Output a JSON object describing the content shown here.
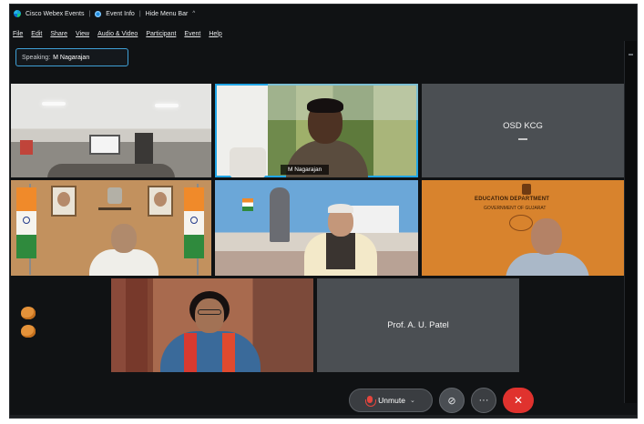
{
  "titlebar": {
    "app_name": "Cisco Webex Events",
    "event_info": "Event Info",
    "hide_menu": "Hide Menu Bar",
    "caret": "^"
  },
  "menu": [
    "File",
    "Edit",
    "Share",
    "View",
    "Audio & Video",
    "Participant",
    "Event",
    "Help"
  ],
  "speaking": {
    "label": "Speaking:",
    "name": "M Nagarajan"
  },
  "tiles": {
    "speaker_name": "M Nagarajan",
    "osd_name": "OSD KCG",
    "edu_line1": "EDUCATION DEPARTMENT",
    "edu_line2": "GOVERNMENT OF GUJARAT",
    "patel_name": "Prof. A. U. Patel"
  },
  "controls": {
    "unmute_label": "Unmute",
    "chevron": "⌄",
    "video_icon": "⊘",
    "more_icon": "···",
    "end_icon": "✕"
  },
  "colors": {
    "active_border": "#22a6e6",
    "end_button": "#e0322e",
    "muted_mic": "#e5453d"
  }
}
